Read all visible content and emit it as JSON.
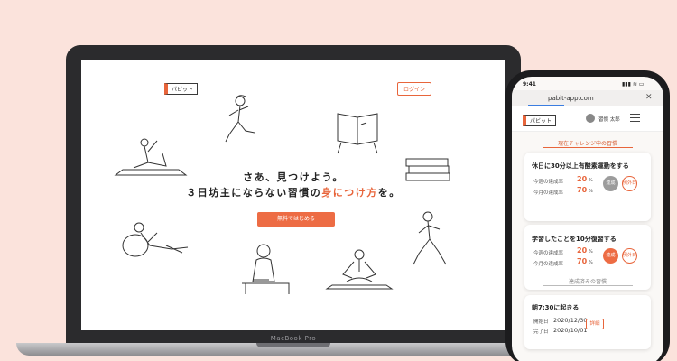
{
  "laptop": {
    "brand": "MacBook Pro",
    "site": {
      "logo": "パビット",
      "login": "ログイン",
      "headline_1": "さあ、見つけよう。",
      "headline_2_pre": "３日坊主にならない習慣の",
      "headline_2_accent": "身につけ方",
      "headline_2_post": "を。",
      "cta": "無料ではじめる"
    }
  },
  "phone": {
    "status": {
      "time": "9:41",
      "icons": "▮▮▮ ≋ ▭"
    },
    "browser": {
      "url": "pabit-app.com",
      "close": "✕"
    },
    "header": {
      "logo": "パビット",
      "user": "習慣 太郎"
    },
    "current_section": "現在チャレンジ中の習慣",
    "habits": [
      {
        "title": "休日に30分以上有酸素運動をする",
        "week_label": "今週の達成率",
        "week_value": "20",
        "month_label": "今月の達成率",
        "month_value": "70",
        "unit": "%",
        "btn_left": "達成",
        "btn_right": "例外日"
      },
      {
        "title": "学習したことを10分復習する",
        "week_label": "今週の達成率",
        "week_value": "20",
        "month_label": "今月の達成率",
        "month_value": "70",
        "unit": "%",
        "btn_left": "達成",
        "btn_right": "例外日"
      }
    ],
    "done_section": "達成済みの習慣",
    "done": {
      "title": "朝7:30に起きる",
      "start_label": "開始日",
      "start_date": "2020/12/30",
      "end_label": "完了日",
      "end_date": "2020/10/01",
      "detail": "詳細"
    }
  },
  "colors": {
    "accent": "#e8653b",
    "background": "#fbe3dc",
    "device": "#2b2b2d"
  }
}
